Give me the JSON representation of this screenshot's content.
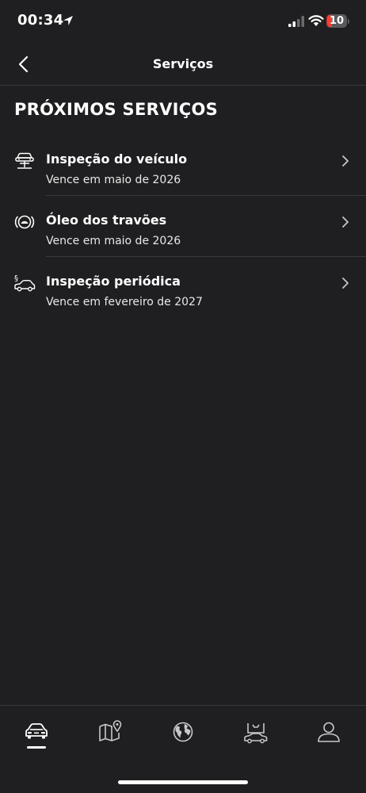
{
  "status_bar": {
    "time": "00:34",
    "battery": "10"
  },
  "header": {
    "title": "Serviços",
    "back_icon": "chevron-left-icon"
  },
  "section": {
    "title": "PRÓXIMOS SERVIÇOS"
  },
  "services": [
    {
      "icon": "car-lift-icon",
      "title": "Inspeção do veículo",
      "subtitle": "Vence em maio de 2026"
    },
    {
      "icon": "brake-fluid-icon",
      "title": "Óleo dos travões",
      "subtitle": "Vence em maio de 2026"
    },
    {
      "icon": "periodic-inspection-icon",
      "title": "Inspeção periódica",
      "subtitle": "Vence em fevereiro de 2027"
    }
  ],
  "tabs": [
    {
      "icon": "car-icon",
      "active": true
    },
    {
      "icon": "map-icon",
      "active": false
    },
    {
      "icon": "globe-icon",
      "active": false
    },
    {
      "icon": "service-car-icon",
      "active": false
    },
    {
      "icon": "profile-icon",
      "active": false
    }
  ],
  "colors": {
    "background": "#1f1f21",
    "divider": "#3a3a3c",
    "battery_low": "#ff3b30"
  }
}
